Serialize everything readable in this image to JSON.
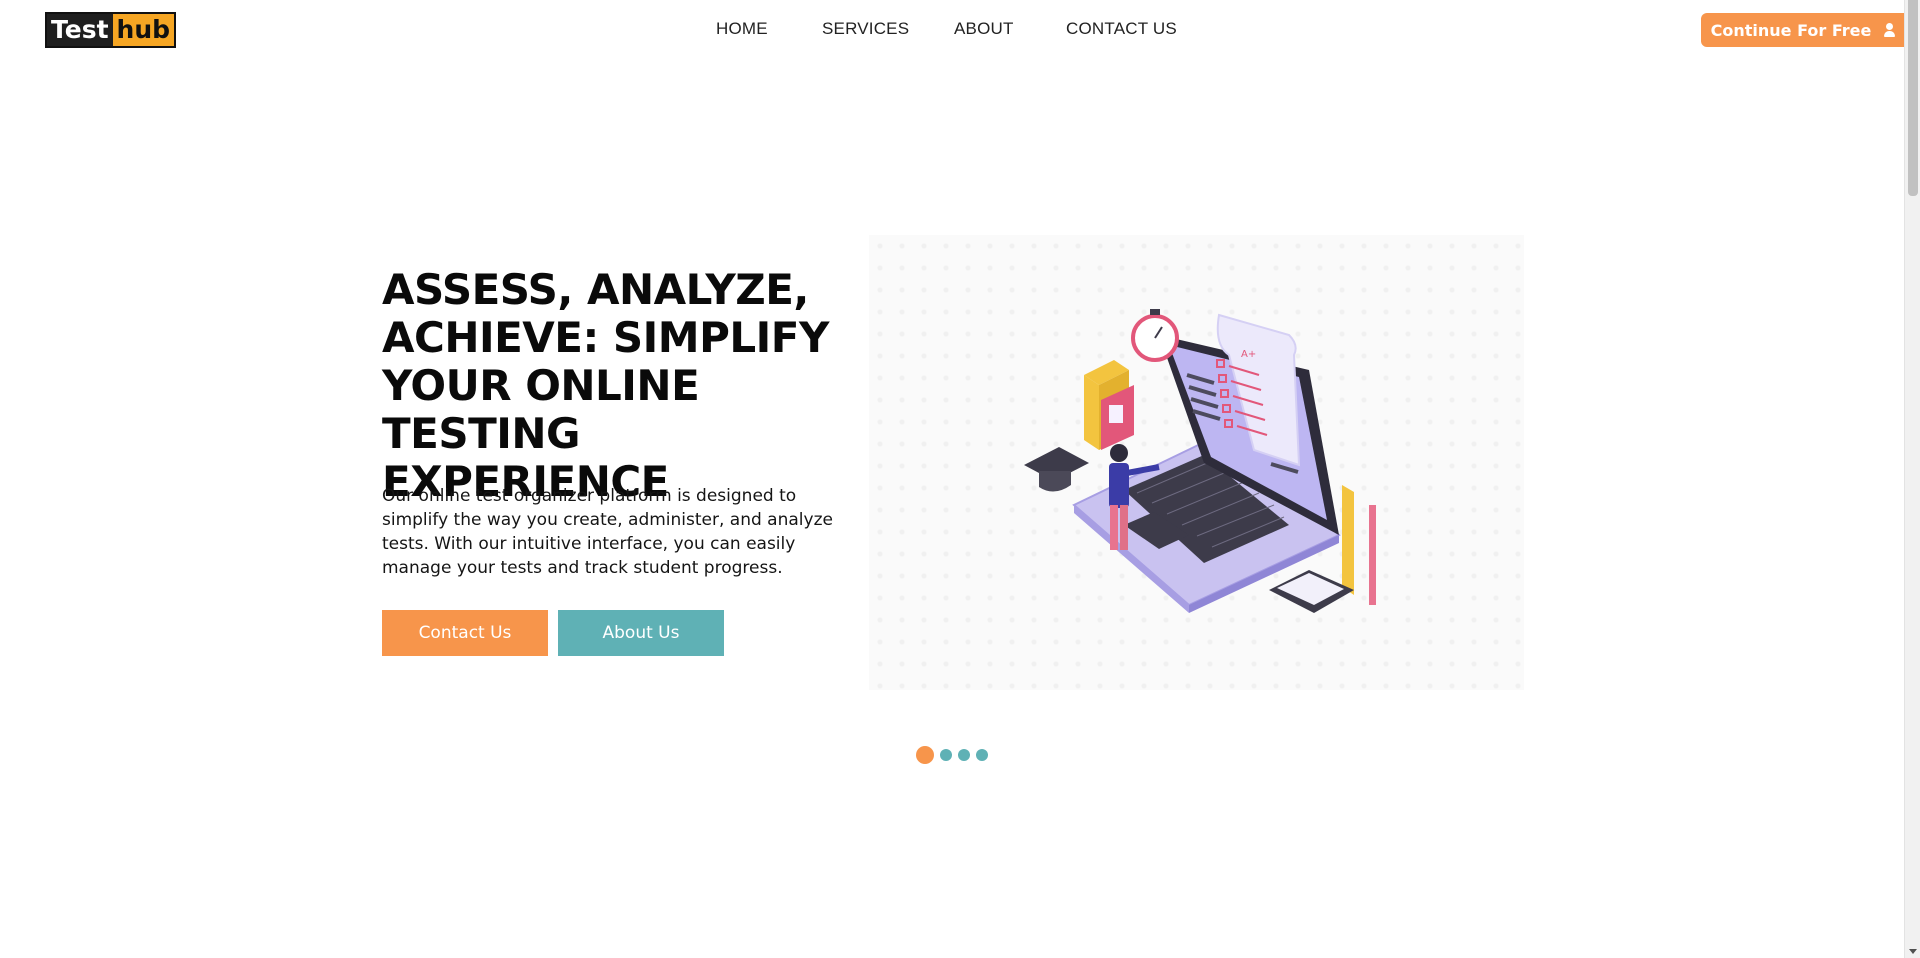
{
  "logo": {
    "part1": "Test",
    "part2": "hub"
  },
  "nav": [
    {
      "label": "HOME"
    },
    {
      "label": "SERVICES"
    },
    {
      "label": "ABOUT"
    },
    {
      "label": "CONTACT US"
    }
  ],
  "header_cta": {
    "label": "Continue For Free",
    "icon": "user-icon"
  },
  "hero": {
    "title": "ASSESS, ANALYZE, ACHIEVE: SIMPLIFY YOUR ONLINE TESTING EXPERIENCE",
    "description": "Our online test organizer platform is designed to simplify the way you create, administer, and analyze tests. With our intuitive interface, you can easily manage your tests and track student progress.",
    "buttons": {
      "contact": "Contact Us",
      "about": "About Us"
    },
    "illustration": {
      "grade_label": "A+"
    }
  },
  "carousel": {
    "slide_count": 4,
    "active_index": 0
  },
  "colors": {
    "accent_orange": "#f7954b",
    "accent_teal": "#5fb1b5",
    "logo_yellow": "#f6a623",
    "logo_dark": "#1f1f1f"
  }
}
